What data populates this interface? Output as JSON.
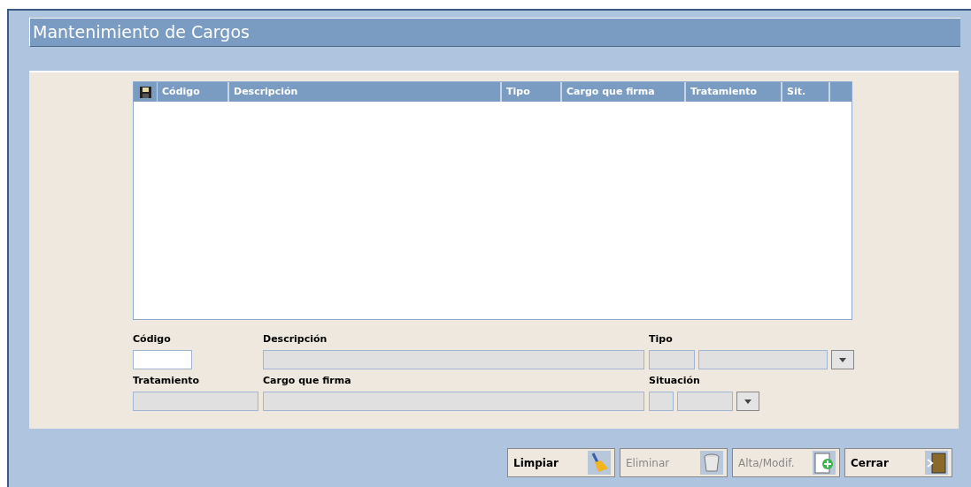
{
  "window": {
    "title": "Mantenimiento de Cargos"
  },
  "grid": {
    "columns": [
      {
        "label": "Código"
      },
      {
        "label": "Descripción"
      },
      {
        "label": "Tipo"
      },
      {
        "label": "Cargo que firma"
      },
      {
        "label": "Tratamiento"
      },
      {
        "label": "Sit."
      }
    ]
  },
  "form": {
    "rows": [
      [
        {
          "label": "Código",
          "fields": [
            {
              "kind": "input",
              "disabled": false
            }
          ]
        },
        {
          "label": "Descripción",
          "fields": [
            {
              "kind": "input",
              "disabled": true
            }
          ]
        },
        {
          "label": "Tipo",
          "fields": [
            {
              "kind": "input",
              "disabled": true
            },
            {
              "kind": "select",
              "disabled": true
            }
          ]
        }
      ],
      [
        {
          "label": "Tratamiento",
          "fields": [
            {
              "kind": "input",
              "disabled": true
            }
          ]
        },
        {
          "label": "Cargo que firma",
          "fields": [
            {
              "kind": "input",
              "disabled": true
            }
          ]
        },
        {
          "label": "Situación",
          "fields": [
            {
              "kind": "input",
              "disabled": true
            },
            {
              "kind": "select",
              "disabled": true
            }
          ]
        }
      ]
    ]
  },
  "buttons": [
    {
      "label": "Limpiar",
      "kind": "broom",
      "disabled": false
    },
    {
      "label": "Eliminar",
      "kind": "trash",
      "disabled": true
    },
    {
      "label": "Alta/Modif.",
      "kind": "add",
      "disabled": true
    },
    {
      "label": "Cerrar",
      "kind": "exit",
      "disabled": false
    }
  ]
}
